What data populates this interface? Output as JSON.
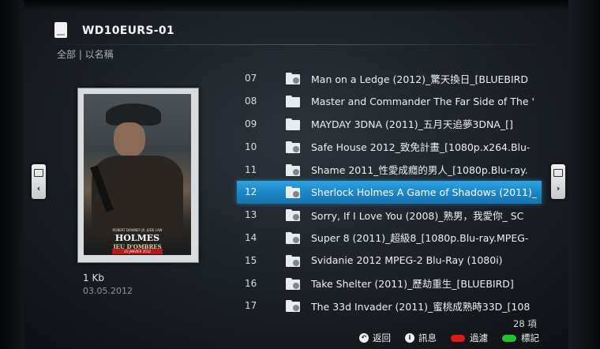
{
  "header": {
    "title": "WD10EURS-01",
    "breadcrumb": "全部 | 以名稱"
  },
  "details": {
    "size": "1 Kb",
    "date": "03.05.2012",
    "poster": {
      "credit": "ROBERT DOWNEY JR. JUDE LAW",
      "title": "HOLMES",
      "subtitle": "JEU D'OMBRES",
      "date_banner": "25 JANVIER 2012"
    }
  },
  "file_list": {
    "items": [
      {
        "num": "07",
        "name": "Man on a Ledge (2012)_驚天換日_[BLUEBIRD",
        "icon": "media-folder-icon",
        "selected": false
      },
      {
        "num": "08",
        "name": "Master and Commander The Far Side of The '",
        "icon": "folder-icon",
        "selected": false
      },
      {
        "num": "09",
        "name": "MAYDAY 3DNA (2011)_五月天追夢3DNA_[]",
        "icon": "folder-icon",
        "selected": false
      },
      {
        "num": "10",
        "name": "Safe House 2012_致免計畫_[1080p.x264.Blu-",
        "icon": "media-folder-icon",
        "selected": false
      },
      {
        "num": "11",
        "name": "Shame 2011_性愛成癮的男人_[1080p.Blu-ray.",
        "icon": "media-folder-icon",
        "selected": false
      },
      {
        "num": "12",
        "name": "Sherlock Holmes A Game of Shadows (2011)_",
        "icon": "media-folder-icon",
        "selected": true
      },
      {
        "num": "13",
        "name": "Sorry, If I Love You (2008)_熟男，我愛你_ SC",
        "icon": "media-folder-icon",
        "selected": false
      },
      {
        "num": "14",
        "name": "Super 8 (2011)_超級8_[1080p.Blu-ray.MPEG-",
        "icon": "media-folder-icon",
        "selected": false
      },
      {
        "num": "15",
        "name": "Svidanie 2012 MPEG-2 Blu-Ray (1080i)",
        "icon": "media-folder-icon",
        "selected": false
      },
      {
        "num": "16",
        "name": "Take Shelter (2011)_歷劫重生_[BLUEBIRD]",
        "icon": "media-folder-icon",
        "selected": false
      },
      {
        "num": "17",
        "name": "The 33d Invader (2011)_蜜桃成熟時33D_[108",
        "icon": "media-folder-icon",
        "selected": false
      }
    ],
    "count": "28 項"
  },
  "footer": {
    "back_label": "返回",
    "info_label": "訊息",
    "filter_label": "過濾",
    "mark_label": "標記",
    "filter_color": "#e01818",
    "mark_color": "#22c22a"
  },
  "colors": {
    "selection": "#1d86c6",
    "background": "#1a1f25"
  }
}
